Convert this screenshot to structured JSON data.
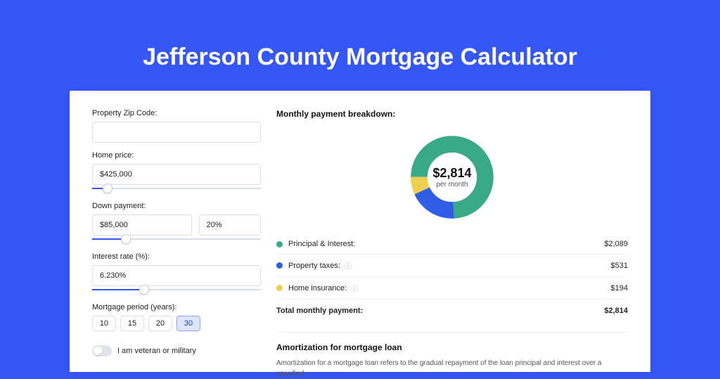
{
  "page": {
    "title": "Jefferson County Mortgage Calculator"
  },
  "form": {
    "zip": {
      "label": "Property Zip Code:",
      "value": ""
    },
    "price": {
      "label": "Home price:",
      "value": "$425,000",
      "slider_pct": 9
    },
    "down": {
      "label": "Down payment:",
      "value": "$85,000",
      "pct": "20%",
      "slider_pct": 20
    },
    "rate": {
      "label": "Interest rate (%):",
      "value": "6.230%",
      "slider_pct": 31
    },
    "period": {
      "label": "Mortgage period (years):",
      "options": [
        "10",
        "15",
        "20",
        "30"
      ],
      "selected": "30"
    },
    "veteran": {
      "label": "I am veteran or military",
      "on": false
    }
  },
  "breakdown": {
    "title": "Monthly payment breakdown:",
    "donut": {
      "value": "$2,814",
      "sub": "per month"
    },
    "items": [
      {
        "color": "#3aa987",
        "name": "Principal & Interest:",
        "info": false,
        "amount": "$2,089"
      },
      {
        "color": "#2f5de6",
        "name": "Property taxes:",
        "info": true,
        "amount": "$531"
      },
      {
        "color": "#efcf4f",
        "name": "Home insurance:",
        "info": true,
        "amount": "$194"
      }
    ],
    "total": {
      "name": "Total monthly payment:",
      "amount": "$2,814"
    }
  },
  "amort": {
    "title": "Amortization for mortgage loan",
    "text": "Amortization for a mortgage loan refers to the gradual repayment of the loan principal and interest over a specified"
  },
  "chart_data": {
    "type": "pie",
    "title": "Monthly payment breakdown",
    "series": [
      {
        "name": "Principal & Interest",
        "value": 2089,
        "color": "#3aa987"
      },
      {
        "name": "Property taxes",
        "value": 531,
        "color": "#2f5de6"
      },
      {
        "name": "Home insurance",
        "value": 194,
        "color": "#efcf4f"
      }
    ],
    "total": 2814,
    "unit": "USD per month"
  }
}
